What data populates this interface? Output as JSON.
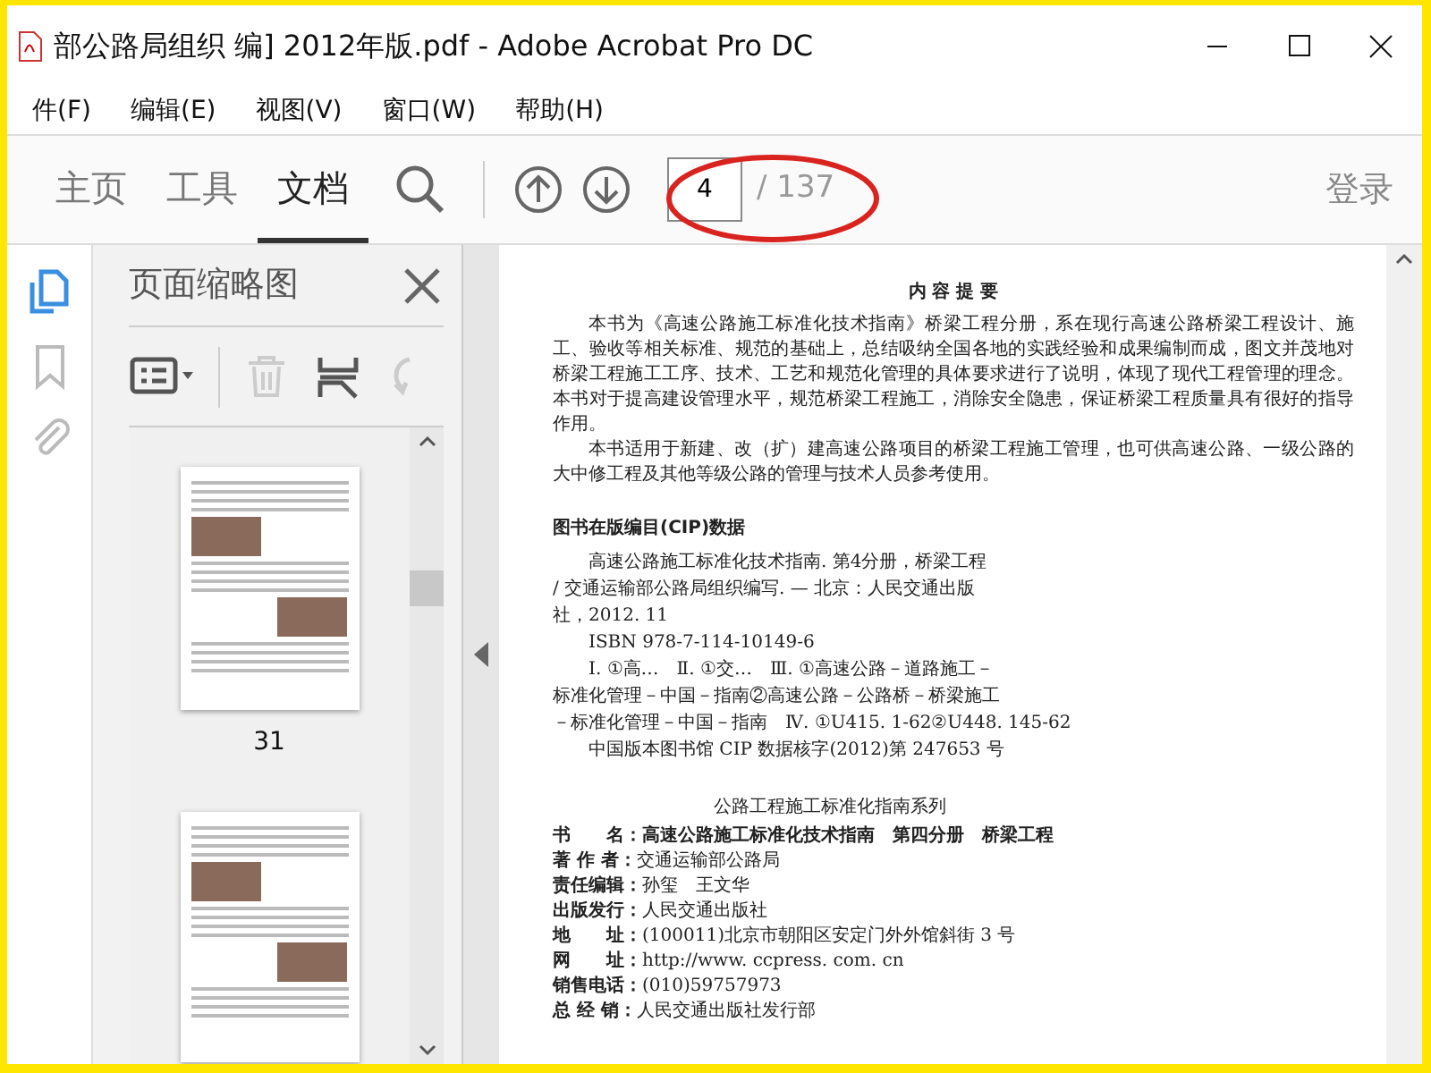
{
  "window": {
    "title": "部公路局组织 编] 2012年版.pdf - Adobe Acrobat Pro DC"
  },
  "menu": [
    "件(F)",
    "编辑(E)",
    "视图(V)",
    "窗口(W)",
    "帮助(H)"
  ],
  "tabs": [
    {
      "label": "主页",
      "selected": false
    },
    {
      "label": "工具",
      "selected": false
    },
    {
      "label": "文档",
      "selected": true
    }
  ],
  "page_nav": {
    "value": "4",
    "total": "/ 137"
  },
  "sign_in": "登录",
  "rail": [
    {
      "kind": "pages",
      "selected": true
    },
    {
      "kind": "bookmark",
      "selected": false
    },
    {
      "kind": "attachment",
      "selected": false
    }
  ],
  "panel": {
    "title": "页面缩略图",
    "tools": [
      {
        "kind": "options",
        "disabled": false
      },
      {
        "kind": "delete",
        "disabled": true
      },
      {
        "kind": "extract",
        "disabled": false
      },
      {
        "kind": "rotate",
        "disabled": true
      }
    ],
    "thumbnails": [
      {
        "label": "31",
        "cut_off": false
      },
      {
        "cut_off": true
      }
    ]
  },
  "document": {
    "summary_title": "内 容 提 要",
    "summary": [
      "本书为《高速公路施工标准化技术指南》桥梁工程分册，系在现行高速公路桥梁工程设计、施工、验收等相关标准、规范的基础上，总结吸纳全国各地的实践经验和成果编制而成，图文并茂地对桥梁工程施工工序、技术、工艺和规范化管理的具体要求进行了说明，体现了现代工程管理的理念。本书对于提高建设管理水平，规范桥梁工程施工，消除安全隐患，保证桥梁工程质量具有很好的指导作用。",
      "本书适用于新建、改（扩）建高速公路项目的桥梁工程施工管理，也可供高速公路、一级公路的大中修工程及其他等级公路的管理与技术人员参考使用。"
    ],
    "cip_title": "图书在版编目(CIP)数据",
    "cip_lines": [
      {
        "text": "高速公路施工标准化技术指南. 第4分册，桥梁工程",
        "indent": true
      },
      {
        "text": "/ 交通运输部公路局组织编写. — 北京：人民交通出版",
        "indent": false
      },
      {
        "text": "社，2012. 11",
        "indent": false
      },
      {
        "text": "ISBN 978-7-114-10149-6",
        "indent": true
      },
      {
        "text": "Ⅰ. ①高…　Ⅱ. ①交…　Ⅲ. ①高速公路－道路施工－",
        "indent": true
      },
      {
        "text": "标准化管理－中国－指南②高速公路－公路桥－桥梁施工",
        "indent": false
      },
      {
        "text": "－标准化管理－中国－指南　Ⅳ. ①U415. 1-62②U448. 145-62",
        "indent": false
      },
      {
        "text": "中国版本图书馆 CIP 数据核字(2012)第 247653 号",
        "indent": true
      }
    ],
    "series": "公路工程施工标准化指南系列",
    "imprint": [
      {
        "label": "书　　名：",
        "value": "高速公路施工标准化技术指南　第四分册　桥梁工程",
        "bold": true
      },
      {
        "label": "著 作 者：",
        "value": "交通运输部公路局",
        "bold": false
      },
      {
        "label": "责任编辑：",
        "value": "孙玺　王文华",
        "bold": false
      },
      {
        "label": "出版发行：",
        "value": "人民交通出版社",
        "bold": false
      },
      {
        "label": "地　　址：",
        "value": "(100011)北京市朝阳区安定门外外馆斜街 3 号",
        "bold": false
      },
      {
        "label": "网　　址：",
        "value": "http://www. ccpress. com. cn",
        "bold": false
      },
      {
        "label": "销售电话：",
        "value": "(010)59757973",
        "bold": false
      },
      {
        "label": "总 经 销：",
        "value": "人民交通出版社发行部",
        "bold": false
      }
    ]
  }
}
